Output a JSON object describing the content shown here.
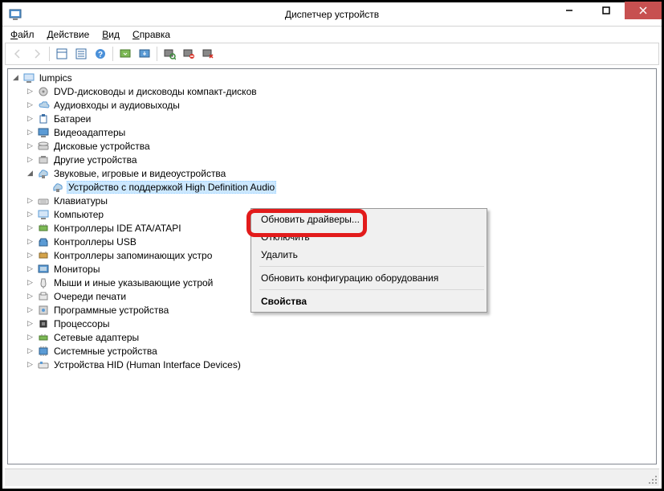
{
  "window": {
    "title": "Диспетчер устройств"
  },
  "menu": {
    "file": "Файл",
    "action": "Действие",
    "view": "Вид",
    "help": "Справка"
  },
  "tree": {
    "root": "lumpics",
    "nodes": [
      "DVD-дисководы и дисководы компакт-дисков",
      "Аудиовходы и аудиовыходы",
      "Батареи",
      "Видеоадаптеры",
      "Дисковые устройства",
      "Другие устройства",
      "Звуковые, игровые и видеоустройства",
      "Клавиатуры",
      "Компьютер",
      "Контроллеры IDE ATA/ATAPI",
      "Контроллеры USB",
      "Контроллеры запоминающих устро",
      "Мониторы",
      "Мыши и иные указывающие устрой",
      "Очереди печати",
      "Программные устройства",
      "Процессоры",
      "Сетевые адаптеры",
      "Системные устройства",
      "Устройства HID (Human Interface Devices)"
    ],
    "selected_child": "Устройство с поддержкой High Definition Audio"
  },
  "context": {
    "update": "Обновить драйверы...",
    "disable": "Отключить",
    "delete": "Удалить",
    "rescan": "Обновить конфигурацию оборудования",
    "properties": "Свойства"
  }
}
